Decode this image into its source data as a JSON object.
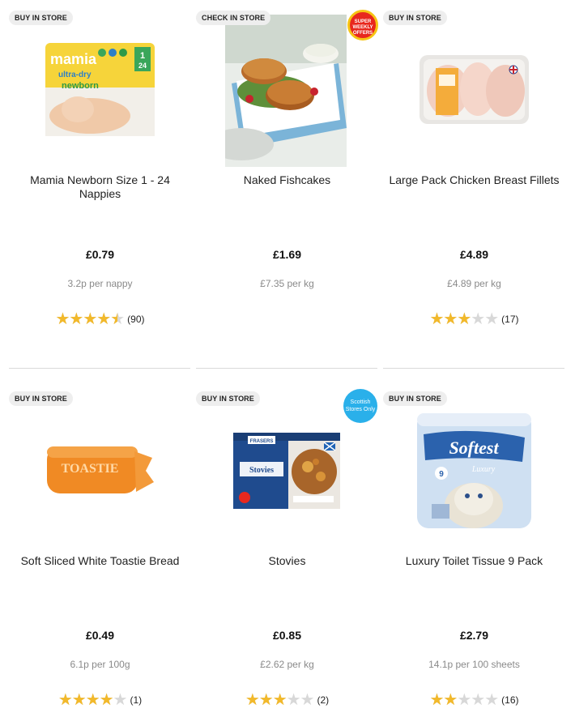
{
  "products": [
    {
      "badge": "BUY IN STORE",
      "image": "nappies-pack-image",
      "image_text": [
        "mamia",
        "ultra-dry",
        "newborn",
        "1",
        "24"
      ],
      "title": "Mamia Newborn Size 1 - 24 Nappies",
      "price": "£0.79",
      "unit_price": "3.2p per nappy",
      "rating": 4.5,
      "reviews": "(90)"
    },
    {
      "badge": "CHECK IN STORE",
      "image": "fishcakes-plate-image",
      "promo": [
        "SUPER",
        "WEEKLY",
        "OFFERS"
      ],
      "title": "Naked Fishcakes",
      "price": "£1.69",
      "unit_price": "£7.35 per kg",
      "rating": null,
      "reviews": ""
    },
    {
      "badge": "BUY IN STORE",
      "image": "chicken-fillets-tray-image",
      "title": "Large Pack Chicken Breast Fillets",
      "price": "£4.89",
      "unit_price": "£4.89 per kg",
      "rating": 3,
      "reviews": "(17)"
    },
    {
      "badge": "BUY IN STORE",
      "image": "toastie-bread-image",
      "image_text": [
        "TOASTIE"
      ],
      "title": "Soft Sliced White Toastie Bread",
      "price": "£0.49",
      "unit_price": "6.1p per 100g",
      "rating": 4,
      "reviews": "(1)"
    },
    {
      "badge": "BUY IN STORE",
      "image": "stovies-box-image",
      "image_text": [
        "FRASERS",
        "Stovies"
      ],
      "promo": [
        "Scottish",
        "Stores Only"
      ],
      "title": "Stovies",
      "price": "£0.85",
      "unit_price": "£2.62 per kg",
      "rating": 3,
      "reviews": "(2)"
    },
    {
      "badge": "BUY IN STORE",
      "image": "toilet-tissue-pack-image",
      "image_text": [
        "Softest",
        "Luxury",
        "9"
      ],
      "title": "Luxury Toilet Tissue 9 Pack",
      "price": "£2.79",
      "unit_price": "14.1p per 100 sheets",
      "rating": 2,
      "reviews": "(16)"
    }
  ],
  "colors": {
    "star_filled": "#f2b92b",
    "star_empty": "#d8d8d8",
    "badge_bg": "#eeeeee",
    "promo_red": "#e8281e",
    "promo_blue": "#2ab0ea"
  }
}
